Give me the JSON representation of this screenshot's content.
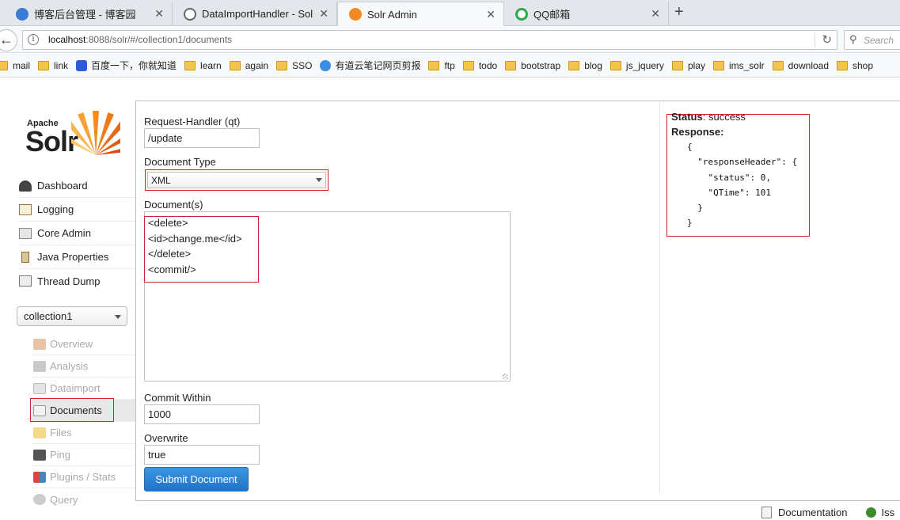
{
  "browser": {
    "tabs": [
      {
        "title": "博客后台管理 - 博客园",
        "color": "#3a7bd5"
      },
      {
        "title": "DataImportHandler - Solr ...",
        "color": "#666666"
      },
      {
        "title": "Solr Admin",
        "color": "#f08a24"
      },
      {
        "title": "QQ邮箱",
        "color": "#2fa84f"
      }
    ],
    "close_glyph": "✕",
    "new_tab_glyph": "+",
    "url_host": "localhost",
    "url_rest": ":8088/solr/#/collection1/documents",
    "search_placeholder": "Search",
    "bookmarks": [
      "mail",
      "link",
      "百度一下，你就知道",
      "learn",
      "again",
      "SSO",
      "有道云笔记网页剪报",
      "ftp",
      "todo",
      "bootstrap",
      "blog",
      "js_jquery",
      "play",
      "ims_solr",
      "download",
      "shop"
    ]
  },
  "sidebar": {
    "logo_apache": "Apache",
    "logo_solr": "Solr",
    "menu": [
      "Dashboard",
      "Logging",
      "Core Admin",
      "Java Properties",
      "Thread Dump"
    ],
    "core_selector": "collection1",
    "core_menu": [
      "Overview",
      "Analysis",
      "Dataimport",
      "Documents",
      "Files",
      "Ping",
      "Plugins / Stats",
      "Query"
    ],
    "selected_core_item": "Documents"
  },
  "form": {
    "request_handler_label": "Request-Handler (qt)",
    "request_handler_value": "/update",
    "document_type_label": "Document Type",
    "document_type_value": "XML",
    "documents_label": "Document(s)",
    "documents_lines": [
      "<delete>",
      "<id>change.me</id>",
      "</delete>",
      "<commit/>"
    ],
    "commit_within_label": "Commit Within",
    "commit_within_value": "1000",
    "overwrite_label": "Overwrite",
    "overwrite_value": "true",
    "submit_label": "Submit Document"
  },
  "response": {
    "status_label": "Status",
    "status_value": "success",
    "response_label": "Response:",
    "json": "{\n  \"responseHeader\": {\n    \"status\": 0,\n    \"QTime\": 101\n  }\n}"
  },
  "footer": {
    "documentation": "Documentation",
    "issues": "Iss"
  },
  "colors": {
    "highlight": "#d32424",
    "button": "#1f73c9"
  }
}
